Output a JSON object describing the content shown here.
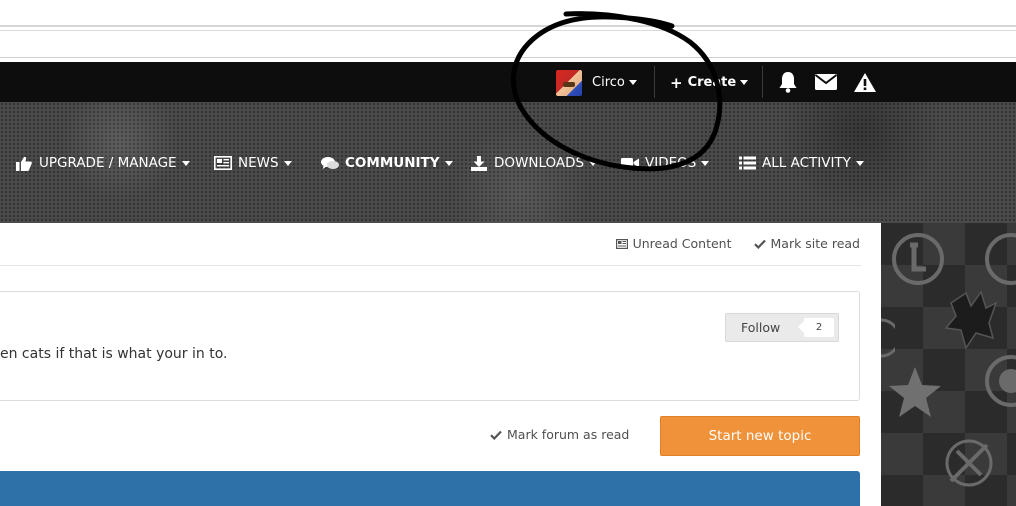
{
  "userbar": {
    "user_name": "Circo",
    "create_label": "Create",
    "icons": [
      "bell-icon",
      "envelope-icon",
      "warning-icon"
    ]
  },
  "nav": {
    "items": [
      {
        "label": "UPGRADE / MANAGE",
        "icon": "thumbs-up-icon",
        "active": false
      },
      {
        "label": "NEWS",
        "icon": "newspaper-icon",
        "active": false
      },
      {
        "label": "COMMUNITY",
        "icon": "comments-icon",
        "active": true
      },
      {
        "label": "DOWNLOADS",
        "icon": "download-icon",
        "active": false
      },
      {
        "label": "VIDEOS",
        "icon": "video-camera-icon",
        "active": false
      },
      {
        "label": "ALL ACTIVITY",
        "icon": "list-icon",
        "active": false
      }
    ]
  },
  "content": {
    "unread_content": "Unread Content",
    "mark_site_read": "Mark site read",
    "forum_description": "en cats if that is what your in to.",
    "follow_label": "Follow",
    "follow_count": "2",
    "mark_forum_read": "Mark forum as read",
    "start_new_topic": "Start new topic"
  },
  "colors": {
    "userbar": "#0d0d0d",
    "accent_orange": "#f0923a",
    "blue_bar": "#2d71a8"
  }
}
